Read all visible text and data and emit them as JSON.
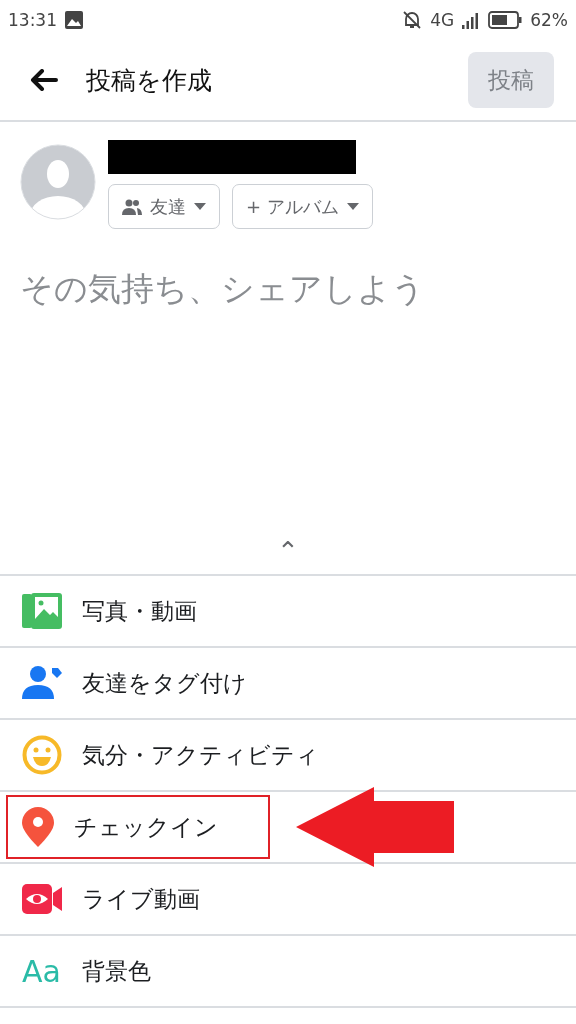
{
  "status_bar": {
    "time": "13:31",
    "network": "4G",
    "battery": "62%"
  },
  "header": {
    "title": "投稿を作成",
    "post_button": {
      "label": "投稿",
      "disabled": true
    }
  },
  "composer": {
    "author_redacted": true,
    "audience": "友達",
    "album": "アルバム",
    "album_prefix": "+",
    "placeholder": "その気持ち、シェアしよう",
    "expand": "⌃"
  },
  "options": [
    {
      "kind": "photo",
      "label": "写真・動画",
      "highlighted": false
    },
    {
      "kind": "tag",
      "label": "友達をタグ付け",
      "highlighted": false
    },
    {
      "kind": "feeling",
      "label": "気分・アクティビティ",
      "highlighted": false
    },
    {
      "kind": "checkin",
      "label": "チェックイン",
      "highlighted": true
    },
    {
      "kind": "live",
      "label": "ライブ動画",
      "highlighted": false
    },
    {
      "kind": "background",
      "label": "背景色",
      "icon_text": "Aa",
      "highlighted": false
    }
  ]
}
